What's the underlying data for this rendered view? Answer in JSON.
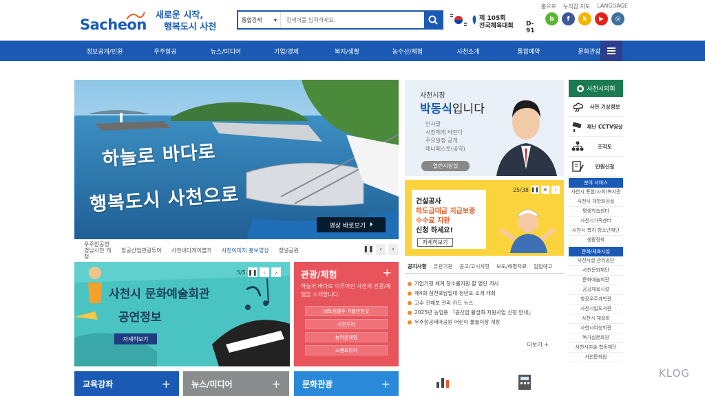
{
  "header": {
    "top_links": [
      "홈으로",
      "누리집 지도",
      "LANGUAGE"
    ],
    "logo_text": "Sacheon",
    "slogan_line1": "새로운 시작,",
    "slogan_line2": "행복도시 사천",
    "search_select": "통합검색",
    "search_placeholder": "검색어를 입력하세요.",
    "event_line1": "제 105회",
    "event_line2": "전국체육대회",
    "event_dday": "D-91",
    "sns": [
      {
        "label": "b",
        "color": "#5bb531"
      },
      {
        "label": "f",
        "color": "#3b5998"
      },
      {
        "label": "k",
        "color": "#f4b400"
      },
      {
        "label": "▶",
        "color": "#e62117"
      },
      {
        "label": "◎",
        "color": "#3f729b"
      }
    ]
  },
  "gnb": {
    "items": [
      "정보공개/민원",
      "우주항공",
      "뉴스/미디어",
      "기업/경제",
      "복지/생활",
      "농수산/체험",
      "사천소개",
      "통합예약",
      "문화관광"
    ],
    "accent": "#1a5ab4"
  },
  "banner": {
    "calligraphy_line1": "하늘로 바다로",
    "calligraphy_line2": "행복도시 사천으로",
    "video_button": "영상 바로보기",
    "tabs": [
      "우주항공청 경남사천 개청",
      "항공산업관광투어",
      "사천바다케이블카",
      "사천이미지 홍보영상",
      "청널공원"
    ],
    "active_tab_index": 3
  },
  "culture": {
    "title": "사천시 문화예술회관",
    "subtitle": "공연정보",
    "more": "자세히보기",
    "pager": "5/5"
  },
  "tour": {
    "title": "관광/체험",
    "desc": "하늘과 바다로 이루어진 사천의 관광/체험을 소개합니다.",
    "links": [
      "비토섬별주 가볼만한곳",
      "사천투어",
      "농어촌체험",
      "스탬프투어"
    ]
  },
  "mayor": {
    "line1": "사천시장",
    "name": "박동식",
    "suffix": "입니다",
    "menu": [
      "인사말",
      "시장에게 바란다",
      "주요일정 공개",
      "매니페스토(공약)"
    ],
    "button": "열린시장실"
  },
  "notice_banner": {
    "line1": "건설공사",
    "line2": "하도급대금 지급보증",
    "line3": "수수료 지원",
    "line4": "신청 하세요!",
    "more": "자세히보기",
    "pager": "25/38"
  },
  "notice_list": {
    "tabs": [
      "공지사항",
      "유관기관",
      "공고/고시사항",
      "보도/해명자료",
      "입법예고"
    ],
    "items": [
      "기업가형 체계 청소률지원 할 명단 게시",
      "제4회 삼천포남일대 청년포 소개 개최",
      "고수 진해보 관리 카드 뉴스",
      "2025년 농업용 『공산업 활성화 지원사업 신청 안내』",
      "우주항공테마공원 어린이 물놀이장 개장"
    ],
    "more": "더보기 +"
  },
  "quick_menu": {
    "council": "사천시의회",
    "items": [
      "사천 기상정보",
      "재난 CCTV영상",
      "조직도",
      "민원신청"
    ],
    "section1": "분야 서비스",
    "section1_items": [
      "사천시 통합(사회)복지관",
      "사천시 개방화장실",
      "평생학습센터",
      "사천시가족센터",
      "사천시 복지 청소년재단",
      "생활정착"
    ],
    "section2": "문화/체육시설",
    "section2_items": [
      "사천시설 관리공단",
      "사천문화재단",
      "문화예술회관",
      "공공체육시설",
      "항공우주과학관",
      "사천시립도서관",
      "사천시 체육회",
      "사천시여성회관",
      "독가실문화원",
      "사천시미술 협동재단",
      "사천문화원"
    ]
  },
  "bottom_tiles": [
    {
      "label": "교육강좌",
      "color": "#1a5ab4"
    },
    {
      "label": "뉴스/미디어",
      "color": "#8b8c8e"
    },
    {
      "label": "문화관광",
      "color": "#2a8ad9"
    }
  ],
  "watermark": "KLOG"
}
